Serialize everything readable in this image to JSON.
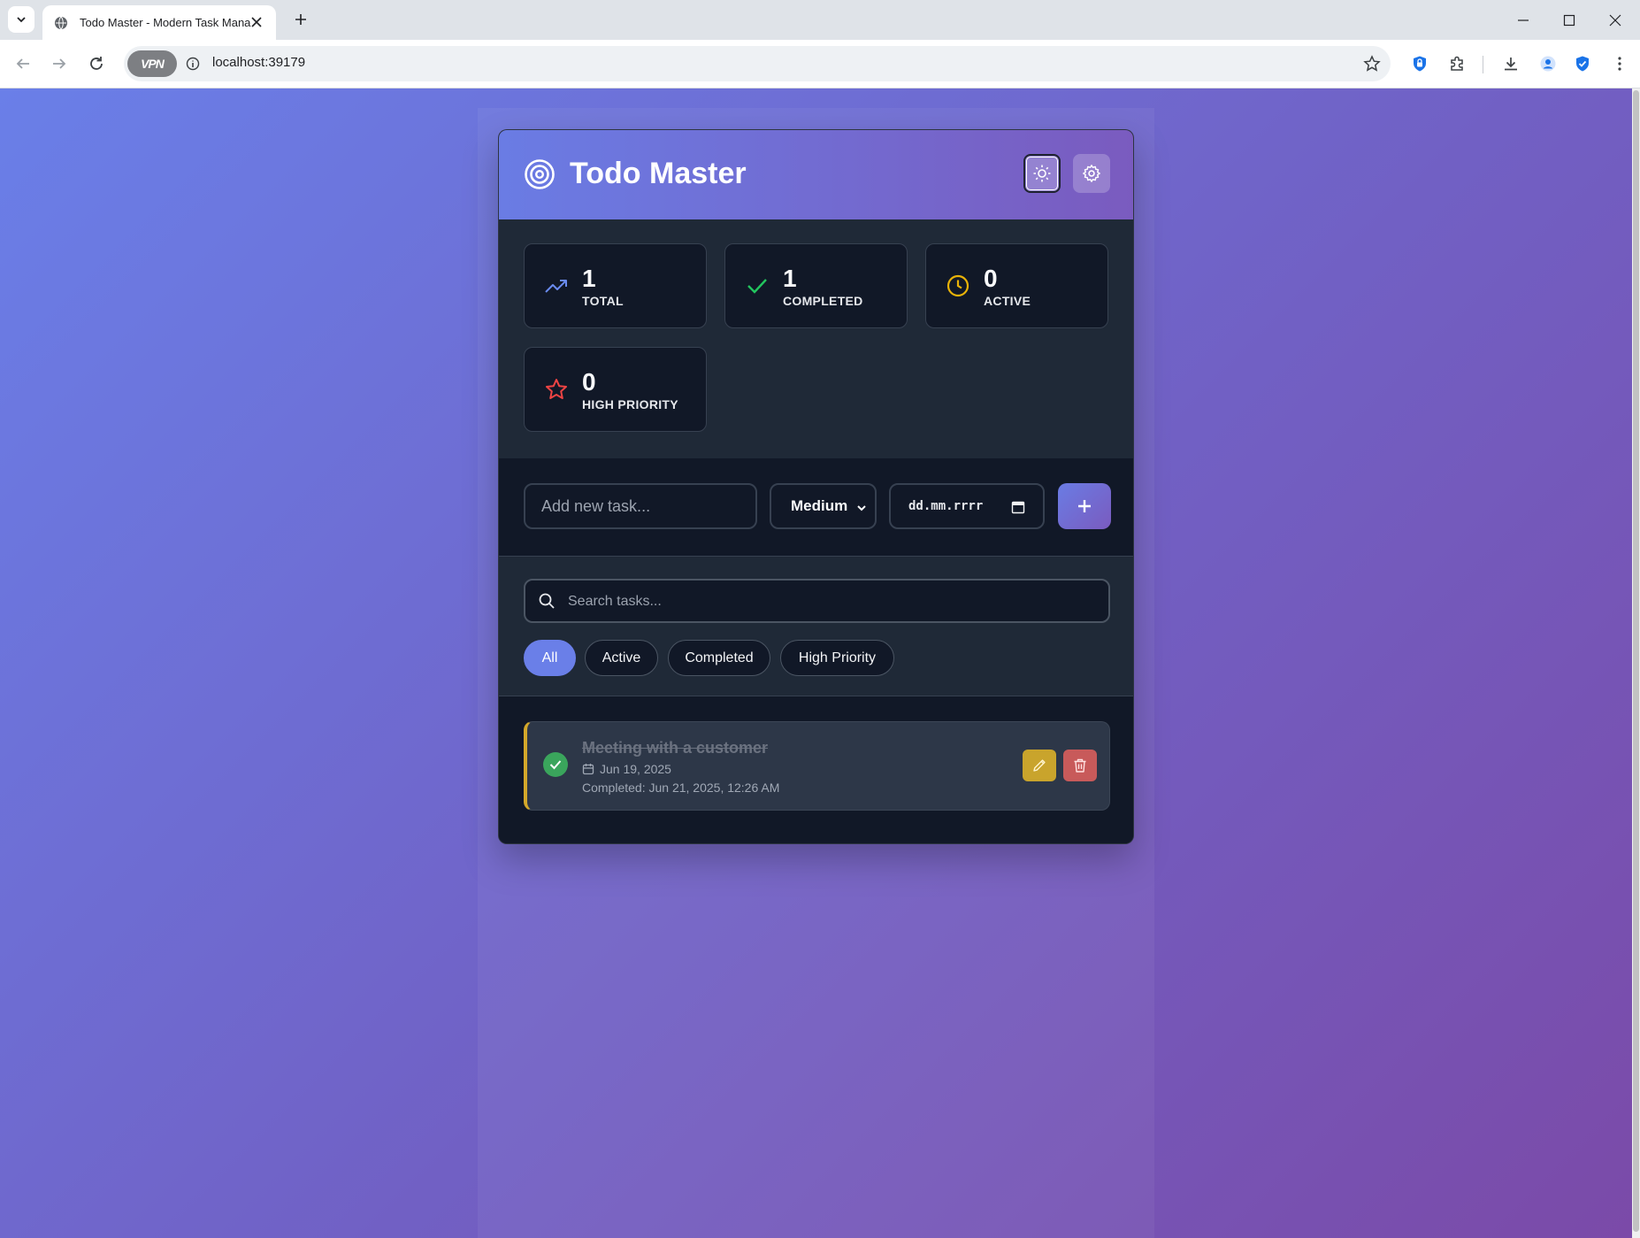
{
  "browser": {
    "tab_title": "Todo Master - Modern Task Manager",
    "url": "localhost:39179",
    "vpn_label": "VPN"
  },
  "header": {
    "title": "Todo Master",
    "logo_icon": "target-icon",
    "theme_icon": "sun-icon",
    "settings_icon": "gear-icon"
  },
  "stats": [
    {
      "value": "1",
      "label": "TOTAL",
      "icon": "trending-up-icon",
      "color": "#6a7fe8"
    },
    {
      "value": "1",
      "label": "COMPLETED",
      "icon": "check-icon",
      "color": "#22c55e"
    },
    {
      "value": "0",
      "label": "ACTIVE",
      "icon": "clock-icon",
      "color": "#eab308"
    },
    {
      "value": "0",
      "label": "HIGH PRIORITY",
      "icon": "star-icon",
      "color": "#ef4444"
    }
  ],
  "add_task": {
    "placeholder": "Add new task...",
    "priority": "Medium",
    "date_placeholder": "dd.mm.rrrr",
    "add_icon": "plus-icon"
  },
  "search": {
    "placeholder": "Search tasks..."
  },
  "filters": [
    {
      "label": "All",
      "active": true
    },
    {
      "label": "Active",
      "active": false
    },
    {
      "label": "Completed",
      "active": false
    },
    {
      "label": "High Priority",
      "active": false
    }
  ],
  "tasks": [
    {
      "title": "Meeting with a customer",
      "date": "Jun 19, 2025",
      "completed_text": "Completed: Jun 21, 2025, 12:26 AM",
      "completed": true,
      "priority_color": "#d4a82a"
    }
  ],
  "colors": {
    "accent": "#6a7fe8",
    "surface": "#111827",
    "panel": "#1f2937",
    "edit": "#c9a42c",
    "delete": "#c85a5a"
  }
}
